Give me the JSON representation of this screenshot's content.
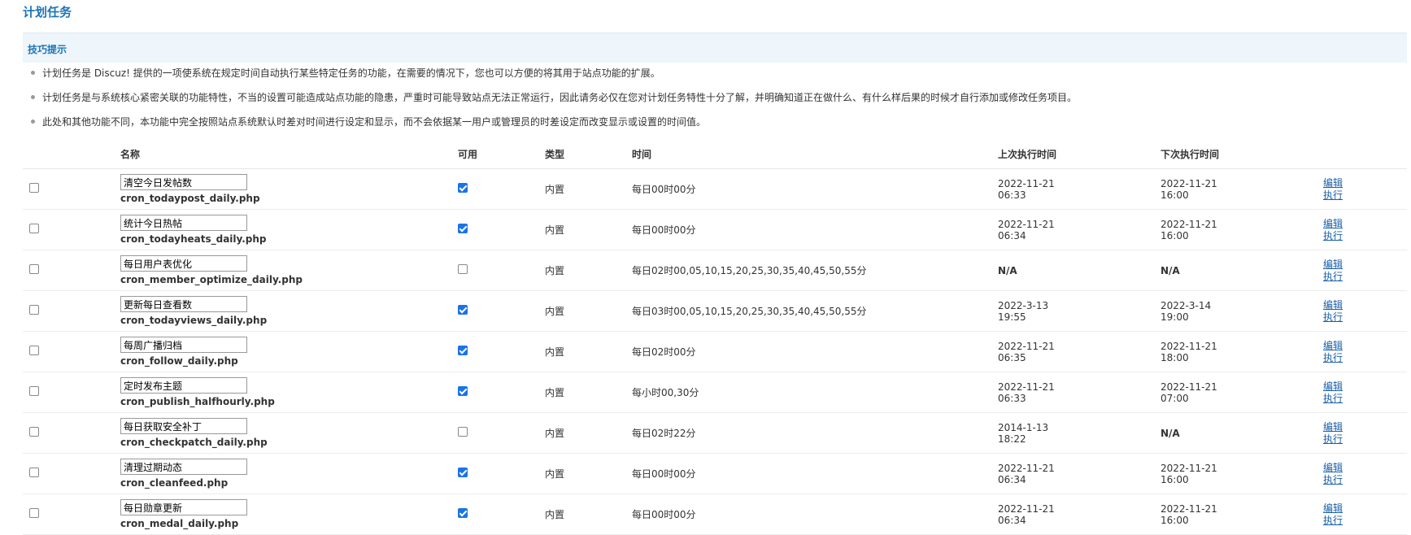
{
  "page_title": "计划任务",
  "tips": {
    "heading": "技巧提示",
    "items": [
      "计划任务是 Discuz! 提供的一项使系统在规定时间自动执行某些特定任务的功能，在需要的情况下，您也可以方便的将其用于站点功能的扩展。",
      "计划任务是与系统核心紧密关联的功能特性，不当的设置可能造成站点功能的隐患，严重时可能导致站点无法正常运行，因此请务必仅在您对计划任务特性十分了解，并明确知道正在做什么、有什么样后果的时候才自行添加或修改任务项目。",
      "此处和其他功能不同，本功能中完全按照站点系统默认时差对时间进行设定和显示，而不会依据某一用户或管理员的时差设定而改变显示或设置的时间值。"
    ]
  },
  "table": {
    "headers": {
      "name": "名称",
      "available": "可用",
      "type": "类型",
      "time": "时间",
      "last_run": "上次执行时间",
      "next_run": "下次执行时间"
    },
    "rows": [
      {
        "name": "清空今日发帖数",
        "file": "cron_todaypost_daily.php",
        "enabled": true,
        "type": "内置",
        "time": "每日00时00分",
        "last": [
          "2022-11-21",
          "06:33"
        ],
        "next": [
          "2022-11-21",
          "16:00"
        ],
        "edit": "编辑",
        "run": "执行"
      },
      {
        "name": "统计今日热帖",
        "file": "cron_todayheats_daily.php",
        "enabled": true,
        "type": "内置",
        "time": "每日00时00分",
        "last": [
          "2022-11-21",
          "06:34"
        ],
        "next": [
          "2022-11-21",
          "16:00"
        ],
        "edit": "编辑",
        "run": "执行"
      },
      {
        "name": "每日用户表优化",
        "file": "cron_member_optimize_daily.php",
        "enabled": false,
        "type": "内置",
        "time": "每日02时00,05,10,15,20,25,30,35,40,45,50,55分",
        "last": [
          "N/A",
          ""
        ],
        "next": [
          "N/A",
          ""
        ],
        "edit": "编辑",
        "run": "执行"
      },
      {
        "name": "更新每日查看数",
        "file": "cron_todayviews_daily.php",
        "enabled": true,
        "type": "内置",
        "time": "每日03时00,05,10,15,20,25,30,35,40,45,50,55分",
        "last": [
          "2022-3-13",
          "19:55"
        ],
        "next": [
          "2022-3-14",
          "19:00"
        ],
        "edit": "编辑",
        "run": "执行"
      },
      {
        "name": "每周广播归档",
        "file": "cron_follow_daily.php",
        "enabled": true,
        "type": "内置",
        "time": "每日02时00分",
        "last": [
          "2022-11-21",
          "06:35"
        ],
        "next": [
          "2022-11-21",
          "18:00"
        ],
        "edit": "编辑",
        "run": "执行"
      },
      {
        "name": "定时发布主题",
        "file": "cron_publish_halfhourly.php",
        "enabled": true,
        "type": "内置",
        "time": "每小时00,30分",
        "last": [
          "2022-11-21",
          "06:33"
        ],
        "next": [
          "2022-11-21",
          "07:00"
        ],
        "edit": "编辑",
        "run": "执行"
      },
      {
        "name": "每日获取安全补丁",
        "file": "cron_checkpatch_daily.php",
        "enabled": false,
        "type": "内置",
        "time": "每日02时22分",
        "last": [
          "2014-1-13",
          "18:22"
        ],
        "next": [
          "N/A",
          ""
        ],
        "edit": "编辑",
        "run": "执行"
      },
      {
        "name": "清理过期动态",
        "file": "cron_cleanfeed.php",
        "enabled": true,
        "type": "内置",
        "time": "每日00时00分",
        "last": [
          "2022-11-21",
          "06:34"
        ],
        "next": [
          "2022-11-21",
          "16:00"
        ],
        "edit": "编辑",
        "run": "执行"
      },
      {
        "name": "每日勋章更新",
        "file": "cron_medal_daily.php",
        "enabled": true,
        "type": "内置",
        "time": "每日00时00分",
        "last": [
          "2022-11-21",
          "06:34"
        ],
        "next": [
          "2022-11-21",
          "16:00"
        ],
        "edit": "编辑",
        "run": "执行"
      }
    ]
  }
}
